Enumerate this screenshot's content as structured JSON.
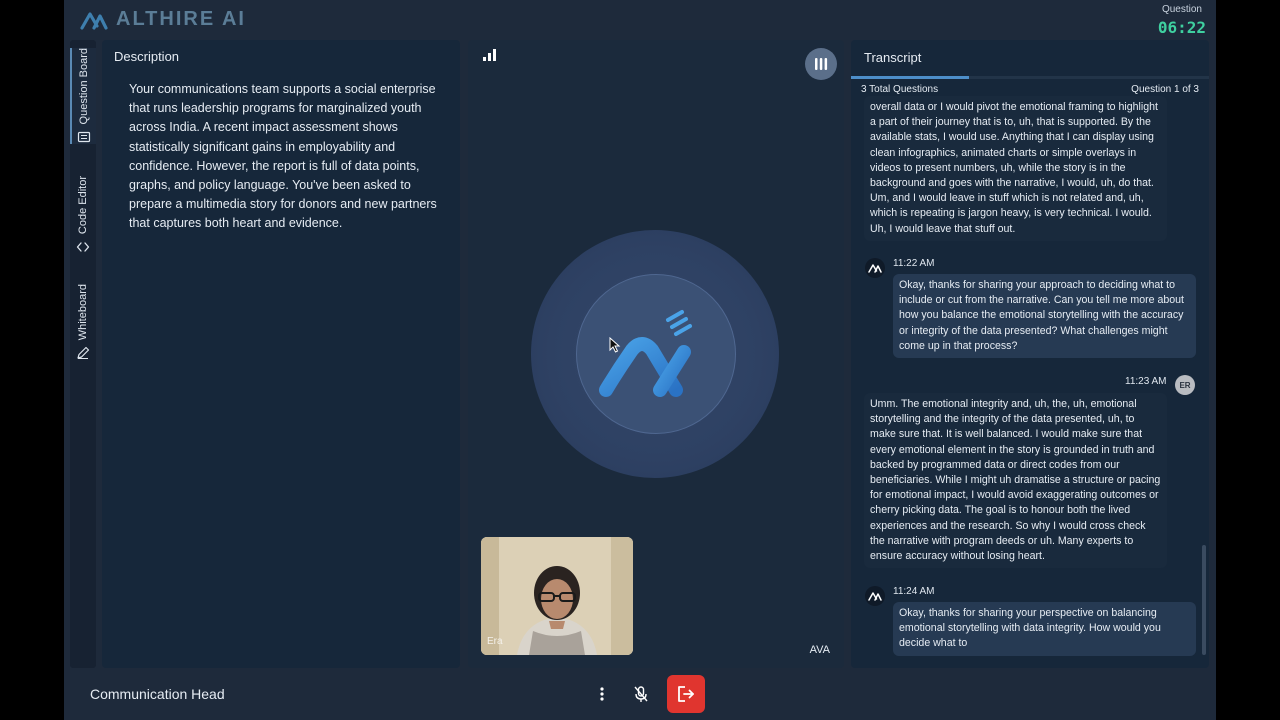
{
  "app": {
    "logo_text": "ALTHIRE AI"
  },
  "timer": {
    "label": "Question",
    "value": "06:22"
  },
  "rail": {
    "items": [
      {
        "label": "Question Board",
        "icon": "board-icon",
        "active": true
      },
      {
        "label": "Code Editor",
        "icon": "code-icon",
        "active": false
      },
      {
        "label": "Whiteboard",
        "icon": "pen-icon",
        "active": false
      }
    ]
  },
  "description": {
    "title": "Description",
    "text": "Your communications team supports a social enterprise that runs leadership programs for marginalized youth across India. A recent impact assessment shows statistically significant gains in employability and confidence. However, the report is full of data points, graphs, and policy language. You've been asked to prepare a multimedia story for donors and new partners that captures both heart and evidence."
  },
  "stage": {
    "participant_name": "Era",
    "ai_name": "AVA"
  },
  "transcript": {
    "title": "Transcript",
    "total_questions": "3 Total Questions",
    "question_progress": "Question 1 of 3",
    "progress_fraction": 0.33,
    "messages": [
      {
        "speaker": "user",
        "time": "",
        "text": "overall data or I would pivot the emotional framing to highlight a part of their journey that is to, uh, that is supported. By the available stats, I would use. Anything that I can display using clean infographics, animated charts or simple overlays in videos to present numbers, uh, while the story is in the background and goes with the narrative, I would, uh, do that. Um, and I would leave in stuff which is not related and, uh, which is repeating is jargon heavy, is very technical. I would. Uh, I would leave that stuff out."
      },
      {
        "speaker": "ai",
        "time": "11:22 AM",
        "text": "Okay, thanks for sharing your approach to deciding what to include or cut from the narrative. Can you tell me more about how you balance the emotional storytelling with the accuracy or integrity of the data presented? What challenges might come up in that process?"
      },
      {
        "speaker": "user",
        "time": "11:23 AM",
        "initials": "ER",
        "text": "Umm. The emotional integrity and, uh, the, uh, emotional storytelling and the integrity of the data presented, uh, to make sure that. It is well balanced. I would make sure that every emotional element in the story is grounded in truth and backed by programmed data or direct codes from our beneficiaries. While I might uh dramatise a structure or pacing for emotional impact, I would avoid exaggerating outcomes or cherry picking data. The goal is to honour both the lived experiences and the research. So why I would cross check the narrative with program deeds or uh. Many experts to ensure accuracy without losing heart."
      },
      {
        "speaker": "ai",
        "time": "11:24 AM",
        "text": "Okay, thanks for sharing your perspective on balancing emotional storytelling with data integrity. How would you decide what to"
      }
    ]
  },
  "footer": {
    "role_title": "Communication Head"
  },
  "icons": {
    "signal": "signal-bars-icon",
    "pause": "pause-icon",
    "more": "more-vertical-icon",
    "mic": "mic-muted-icon",
    "leave": "leave-call-icon"
  },
  "colors": {
    "accent": "#4d8ec9",
    "timer": "#3fd0a0",
    "leave": "#e0352f"
  }
}
